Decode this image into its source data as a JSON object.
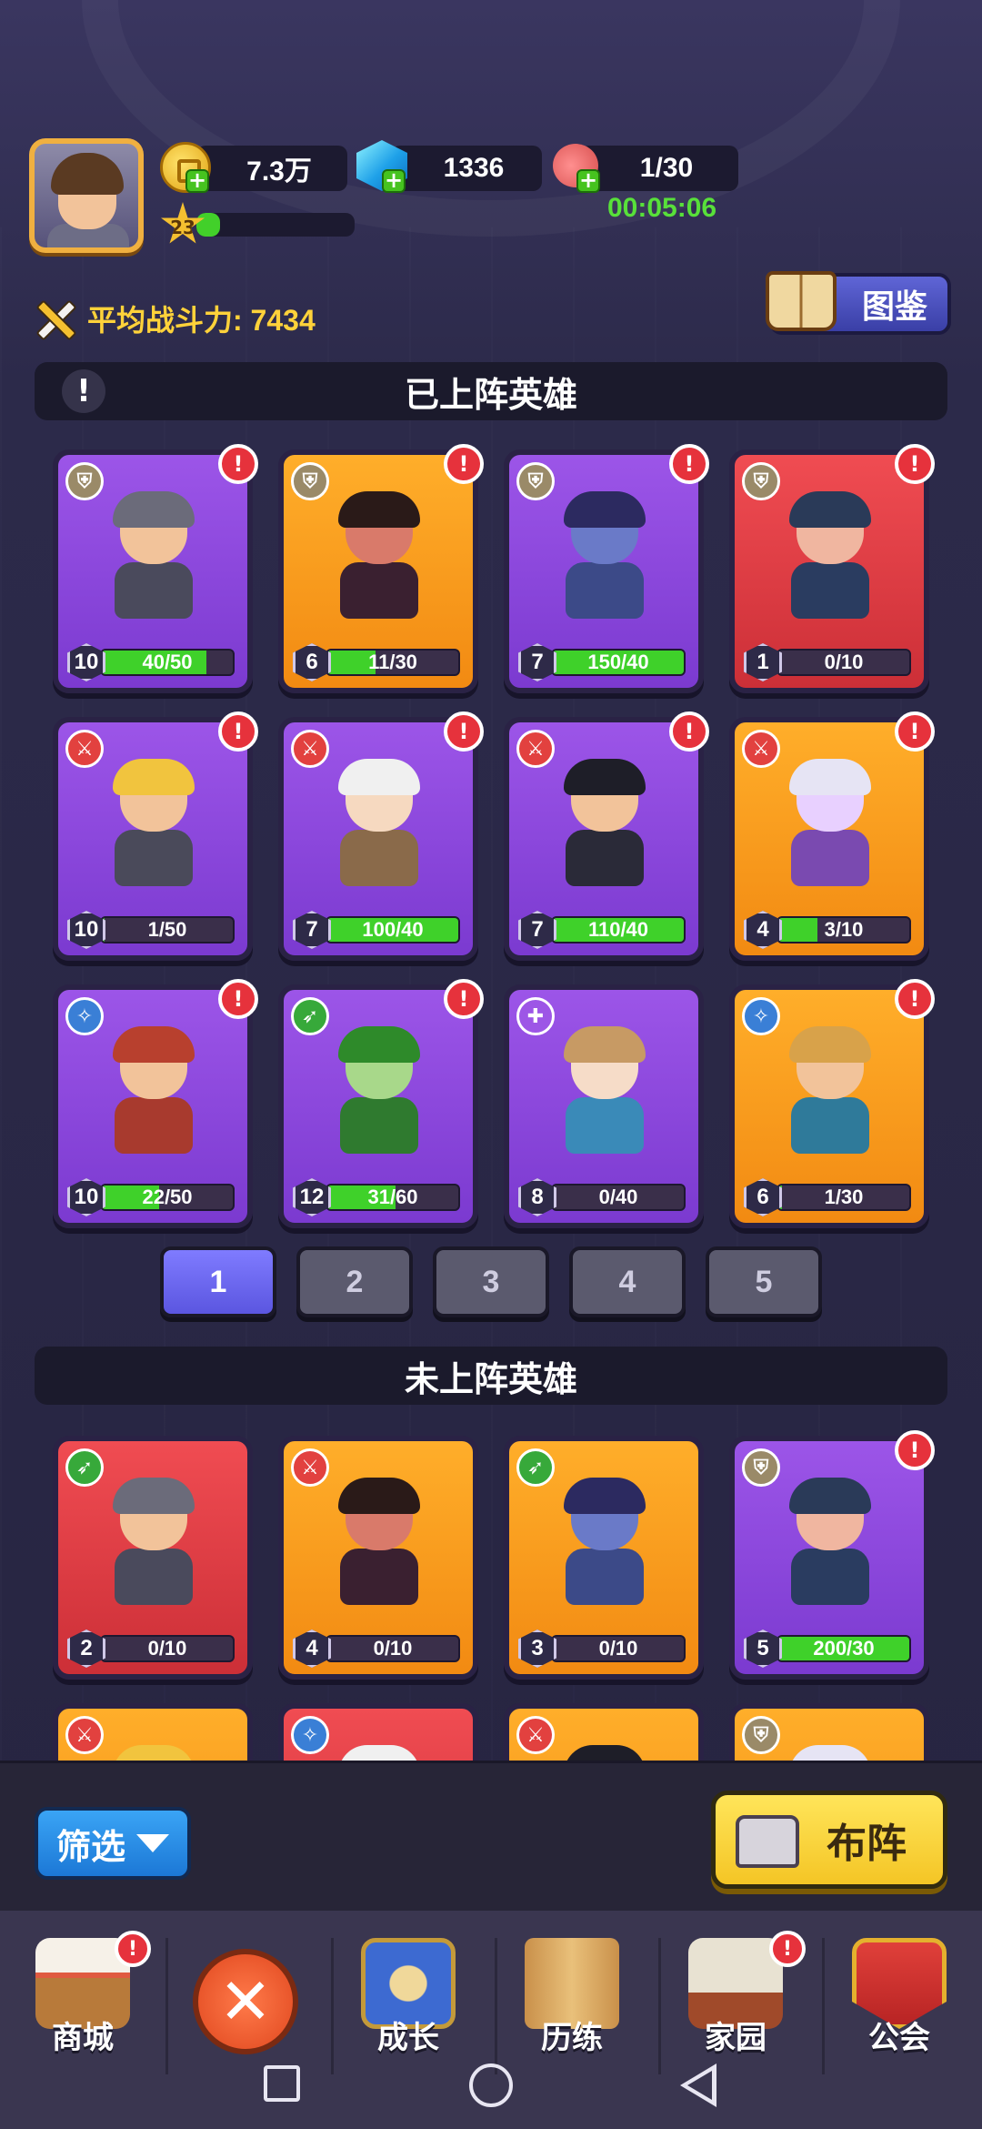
{
  "resources": {
    "gold": "7.3万",
    "gems": "1336",
    "stamina": "1/30",
    "stamina_timer": "00:05:06"
  },
  "player": {
    "level": "23",
    "xp_fraction": 0.15
  },
  "power": {
    "label": "平均战斗力: 7434"
  },
  "codex_button": "图鉴",
  "deployed_section": {
    "title": "已上阵英雄",
    "info_icon": "!",
    "heroes": [
      {
        "level": "10",
        "fragments": "40/50",
        "fill": 0.8,
        "color": "purple",
        "class": "shield",
        "alert": true
      },
      {
        "level": "6",
        "fragments": "11/30",
        "fill": 0.37,
        "color": "orange",
        "class": "shield",
        "alert": true
      },
      {
        "level": "7",
        "fragments": "150/40",
        "fill": 1.0,
        "color": "purple",
        "class": "shield",
        "alert": true
      },
      {
        "level": "1",
        "fragments": "0/10",
        "fill": 0.0,
        "color": "red",
        "class": "shield",
        "alert": true
      },
      {
        "level": "10",
        "fragments": "1/50",
        "fill": 0.02,
        "color": "purple",
        "class": "sword",
        "alert": true
      },
      {
        "level": "7",
        "fragments": "100/40",
        "fill": 1.0,
        "color": "purple",
        "class": "sword",
        "alert": true
      },
      {
        "level": "7",
        "fragments": "110/40",
        "fill": 1.0,
        "color": "purple",
        "class": "sword",
        "alert": true
      },
      {
        "level": "4",
        "fragments": "3/10",
        "fill": 0.3,
        "color": "orange",
        "class": "sword",
        "alert": true
      },
      {
        "level": "10",
        "fragments": "22/50",
        "fill": 0.44,
        "color": "purple",
        "class": "magic",
        "alert": true
      },
      {
        "level": "12",
        "fragments": "31/60",
        "fill": 0.52,
        "color": "purple",
        "class": "bow",
        "alert": true
      },
      {
        "level": "8",
        "fragments": "0/40",
        "fill": 0.0,
        "color": "purple",
        "class": "heal",
        "alert": false
      },
      {
        "level": "6",
        "fragments": "1/30",
        "fill": 0.03,
        "color": "orange",
        "class": "magic",
        "alert": true
      }
    ]
  },
  "pager": {
    "pages": [
      "1",
      "2",
      "3",
      "4",
      "5"
    ],
    "active": "1"
  },
  "bench_section": {
    "title": "未上阵英雄",
    "heroes": [
      {
        "level": "2",
        "fragments": "0/10",
        "fill": 0.0,
        "color": "red",
        "class": "bow",
        "alert": false
      },
      {
        "level": "4",
        "fragments": "0/10",
        "fill": 0.0,
        "color": "orange",
        "class": "sword",
        "alert": false
      },
      {
        "level": "3",
        "fragments": "0/10",
        "fill": 0.0,
        "color": "orange",
        "class": "bow",
        "alert": false
      },
      {
        "level": "5",
        "fragments": "200/30",
        "fill": 1.0,
        "color": "purple",
        "class": "shield",
        "alert": true
      },
      {
        "level": "",
        "fragments": "",
        "fill": 0.0,
        "color": "orange",
        "class": "sword",
        "alert": false
      },
      {
        "level": "",
        "fragments": "",
        "fill": 0.0,
        "color": "red",
        "class": "magic",
        "alert": false
      },
      {
        "level": "",
        "fragments": "",
        "fill": 0.0,
        "color": "orange",
        "class": "sword",
        "alert": false
      },
      {
        "level": "",
        "fragments": "",
        "fill": 0.0,
        "color": "orange",
        "class": "shield",
        "alert": false
      }
    ]
  },
  "actions": {
    "filter": "筛选",
    "formation": "布阵"
  },
  "nav": {
    "shop": "商城",
    "growth": "成长",
    "trials": "历练",
    "home": "家园",
    "guild": "公会",
    "close_icon": "✕"
  },
  "colors": {
    "purple": "#8b47dc",
    "orange": "#f99c1e",
    "red": "#e03d44",
    "accent_green": "#3fd12a",
    "alert_red": "#e6323c"
  }
}
